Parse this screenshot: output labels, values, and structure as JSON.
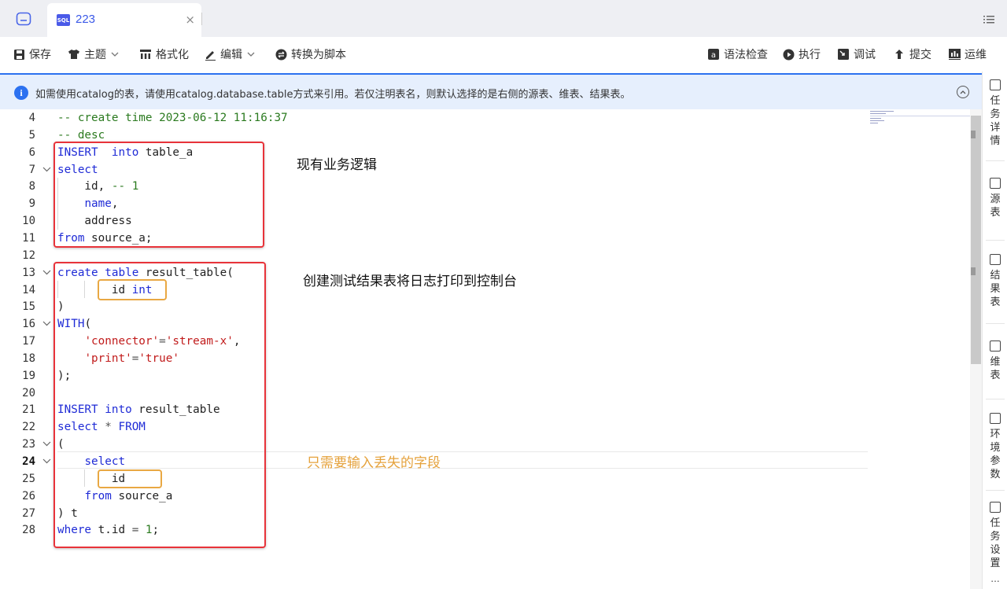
{
  "tab": {
    "badge": "SQL",
    "title": "223",
    "close": "×"
  },
  "toolbar": {
    "save": "保存",
    "theme": "主题",
    "format": "格式化",
    "edit": "编辑",
    "to_script": "转换为脚本",
    "syntax_check": "语法检查",
    "run": "执行",
    "debug": "调试",
    "submit": "提交",
    "ops": "运维"
  },
  "banner": {
    "text": "如需使用catalog的表，请使用catalog.database.table方式来引用。若仅注明表名，则默认选择的是右侧的源表、维表、结果表。"
  },
  "side_panel": {
    "items": [
      {
        "label": "任务详情",
        "icon": "document-icon"
      },
      {
        "label": "源表",
        "icon": "source-table-icon"
      },
      {
        "label": "结果表",
        "icon": "result-table-icon"
      },
      {
        "label": "维表",
        "icon": "dimension-table-icon"
      },
      {
        "label": "环境参数",
        "icon": "settings-sliders-icon"
      },
      {
        "label": "任务设置",
        "icon": "task-settings-icon"
      }
    ],
    "more": "..."
  },
  "editor": {
    "current_line": 24,
    "line_numbers": [
      "4",
      "5",
      "6",
      "7",
      "8",
      "9",
      "10",
      "11",
      "12",
      "13",
      "14",
      "15",
      "16",
      "17",
      "18",
      "19",
      "20",
      "21",
      "22",
      "23",
      "24",
      "25",
      "26",
      "27",
      "28"
    ],
    "lines": [
      {
        "t": [
          [
            "cmt",
            "-- create time 2023-06-12 11:16:37"
          ]
        ]
      },
      {
        "t": [
          [
            "cmt",
            "-- desc"
          ]
        ]
      },
      {
        "t": [
          [
            "kw",
            "INSERT"
          ],
          [
            "",
            "  "
          ],
          [
            "kw",
            "into"
          ],
          [
            "",
            " table_a"
          ]
        ]
      },
      {
        "t": [
          [
            "kw",
            "select"
          ]
        ]
      },
      {
        "t": [
          [
            "",
            "    id, "
          ],
          [
            "cmt",
            "-- 1"
          ]
        ]
      },
      {
        "t": [
          [
            "",
            "    "
          ],
          [
            "kw",
            "name"
          ],
          [
            "",
            ","
          ]
        ]
      },
      {
        "t": [
          [
            "",
            "    address"
          ]
        ]
      },
      {
        "t": [
          [
            "kw",
            "from"
          ],
          [
            "",
            " source_a;"
          ]
        ]
      },
      {
        "t": []
      },
      {
        "t": [
          [
            "kw",
            "create"
          ],
          [
            "",
            " "
          ],
          [
            "kw",
            "table"
          ],
          [
            "",
            " result_table("
          ]
        ]
      },
      {
        "t": [
          [
            "",
            "        id "
          ],
          [
            "kw",
            "int"
          ]
        ]
      },
      {
        "t": [
          [
            "",
            ")"
          ]
        ]
      },
      {
        "t": [
          [
            "kw",
            "WITH"
          ],
          [
            "",
            "("
          ]
        ]
      },
      {
        "t": [
          [
            "",
            "    "
          ],
          [
            "str",
            "'connector'"
          ],
          [
            "op",
            "="
          ],
          [
            "str",
            "'stream-x'"
          ],
          [
            "",
            ","
          ]
        ]
      },
      {
        "t": [
          [
            "",
            "    "
          ],
          [
            "str",
            "'print'"
          ],
          [
            "op",
            "="
          ],
          [
            "str",
            "'true'"
          ]
        ]
      },
      {
        "t": [
          [
            "",
            ");"
          ]
        ]
      },
      {
        "t": []
      },
      {
        "t": [
          [
            "kw",
            "INSERT"
          ],
          [
            "",
            " "
          ],
          [
            "kw",
            "into"
          ],
          [
            "",
            " result_table"
          ]
        ]
      },
      {
        "t": [
          [
            "kw",
            "select"
          ],
          [
            "",
            " "
          ],
          [
            "op",
            "*"
          ],
          [
            "",
            " "
          ],
          [
            "kw",
            "FROM"
          ]
        ]
      },
      {
        "t": [
          [
            "",
            "("
          ]
        ]
      },
      {
        "t": [
          [
            "",
            "    "
          ],
          [
            "kw",
            "select"
          ]
        ]
      },
      {
        "t": [
          [
            "",
            "        id"
          ]
        ]
      },
      {
        "t": [
          [
            "",
            "    "
          ],
          [
            "kw",
            "from"
          ],
          [
            "",
            " source_a"
          ]
        ]
      },
      {
        "t": [
          [
            "",
            ") t"
          ]
        ]
      },
      {
        "t": [
          [
            "kw",
            "where"
          ],
          [
            "",
            " t.id "
          ],
          [
            "op",
            "="
          ],
          [
            "",
            " "
          ],
          [
            "num",
            "1"
          ],
          [
            "",
            ";"
          ]
        ]
      }
    ],
    "fold_lines": [
      "7",
      "13",
      "16",
      "23",
      "24"
    ]
  },
  "annotations": {
    "existing_logic": "现有业务逻辑",
    "create_result": "创建测试结果表将日志打印到控制台",
    "missing_fields": "只需要输入丢失的字段"
  },
  "colors": {
    "accent": "#2c71f0",
    "red_box": "#e8333a",
    "orange_box": "#e9a843",
    "keyword": "#1f2bd6",
    "string": "#c11b1b",
    "comment": "#2b7a1f"
  }
}
